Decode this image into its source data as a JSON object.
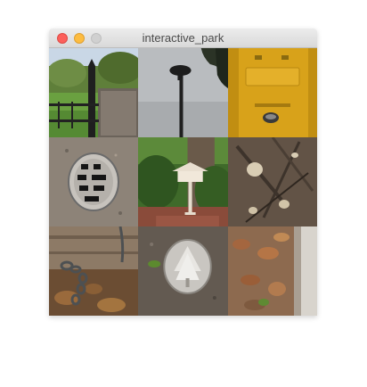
{
  "window": {
    "title": "interactive_park",
    "controls": [
      "close",
      "minimize",
      "zoom"
    ]
  },
  "grid": {
    "rows": 3,
    "columns": 3,
    "tiles": [
      {
        "name": "fence-tile",
        "icon": "park-fence-image"
      },
      {
        "name": "lamp-post-tile",
        "icon": "street-lamp-image"
      },
      {
        "name": "yellow-box-tile",
        "icon": "yellow-post-box-image"
      },
      {
        "name": "drain-cover-tile",
        "icon": "drain-cover-image"
      },
      {
        "name": "birdhouse-tile",
        "icon": "birdhouse-image"
      },
      {
        "name": "cut-branches-tile",
        "icon": "cut-branches-image"
      },
      {
        "name": "chain-log-tile",
        "icon": "chain-on-log-image"
      },
      {
        "name": "plaque-tile",
        "icon": "ground-plaque-image"
      },
      {
        "name": "leaves-tile",
        "icon": "fallen-leaves-image"
      }
    ]
  },
  "colors": {
    "close": "#fc605b",
    "minimize": "#fdbc40",
    "zoom": "#d0d0d0",
    "titlebar": "#e3e3e3"
  }
}
